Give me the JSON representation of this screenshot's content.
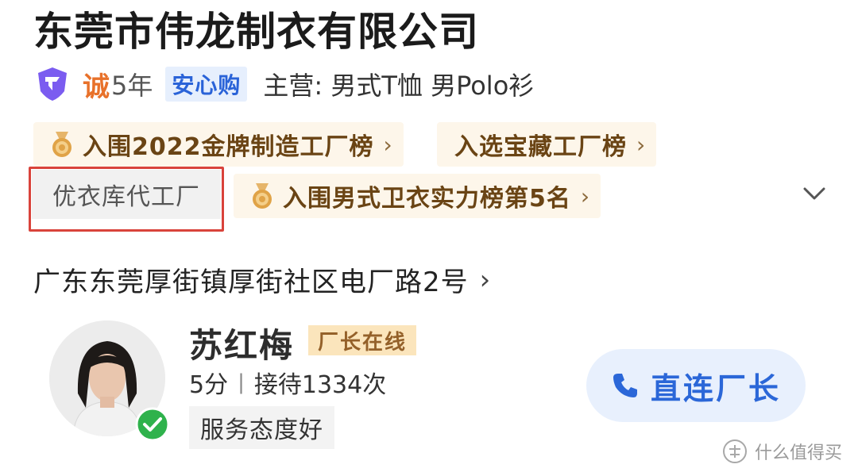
{
  "company": {
    "name": "东莞市伟龙制衣有限公司"
  },
  "credentials": {
    "cheng_char": "诚",
    "years": "5年",
    "anxin_label": "安心购",
    "main_business": "主营: 男式T恤 男Polo衫"
  },
  "tags": {
    "rank_gold": "入围2022金牌制造工厂榜",
    "rank_treasure": "入选宝藏工厂榜",
    "oem": "优衣库代工厂",
    "rank_hoodie": "入围男式卫衣实力榜第5名",
    "chevron": "›"
  },
  "address": {
    "text": "广东东莞厚街镇厚街社区电厂路2号",
    "chevron": "›"
  },
  "contact": {
    "name": "苏红梅",
    "online_badge": "厂长在线",
    "score": "5分",
    "separator": "|",
    "receptions": "接待1334次",
    "service_tag": "服务态度好",
    "call_button": "直连厂长"
  },
  "watermark": {
    "text": "什么值得买"
  },
  "icons": {
    "certified": "shield-badge-icon",
    "medal": "medal-icon",
    "expand": "chevron-down-icon",
    "verified": "check-circle-icon",
    "phone": "phone-icon",
    "watermark_logo": "smzdm-logo-icon"
  },
  "colors": {
    "brand_blue": "#2b67d8",
    "tag_bg": "#fdf6ea",
    "tag_text": "#6a4414",
    "highlight_red": "#d9433b",
    "online_bg": "#fbe5bc",
    "verified_green": "#2fb24c"
  }
}
